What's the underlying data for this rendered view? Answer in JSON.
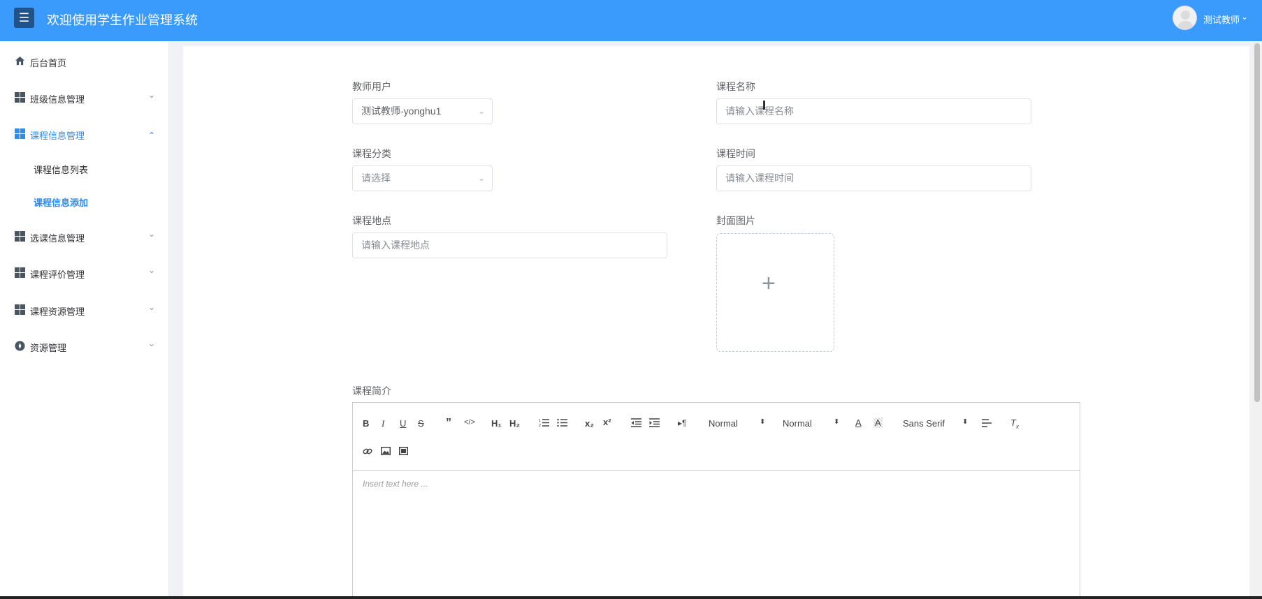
{
  "header": {
    "menu_icon": "hamburger-icon",
    "title": "欢迎使用学生作业管理系统",
    "user_name": "测试教师",
    "user_caret": "⌄",
    "accent": "#3a9bfd"
  },
  "sidebar": {
    "items": [
      {
        "label": "后台首页",
        "icon": "home-icon"
      },
      {
        "label": "班级信息管理",
        "icon": "grid-icon",
        "chevron": "⌄"
      },
      {
        "label": "课程信息管理",
        "icon": "grid-icon",
        "chevron": "⌃",
        "expanded": true
      },
      {
        "label": "选课信息管理",
        "icon": "grid-icon",
        "chevron": "⌄"
      },
      {
        "label": "课程评价管理",
        "icon": "grid-icon",
        "chevron": "⌄"
      },
      {
        "label": "课程资源管理",
        "icon": "grid-icon",
        "chevron": "⌄"
      },
      {
        "label": "资源管理",
        "icon": "compass-icon",
        "chevron": "⌄"
      }
    ],
    "subitems": [
      {
        "label": "课程信息列表"
      },
      {
        "label": "课程信息添加",
        "active": true
      }
    ],
    "active_color": "#2d8cf0"
  },
  "form": {
    "teacher": {
      "label": "教师用户",
      "value": "测试教师-yonghu1"
    },
    "course_name": {
      "label": "课程名称",
      "placeholder": "请输入课程名称"
    },
    "category": {
      "label": "课程分类",
      "placeholder": "请选择"
    },
    "course_time": {
      "label": "课程时间",
      "placeholder": "请输入课程时间"
    },
    "location": {
      "label": "课程地点",
      "placeholder": "请输入课程地点"
    },
    "cover": {
      "label": "封面图片",
      "icon": "plus-icon"
    },
    "intro": {
      "label": "课程简介"
    }
  },
  "editor": {
    "header_select": "Normal",
    "size_select": "Normal",
    "font_select": "Sans Serif",
    "placeholder": "Insert text here ..."
  }
}
